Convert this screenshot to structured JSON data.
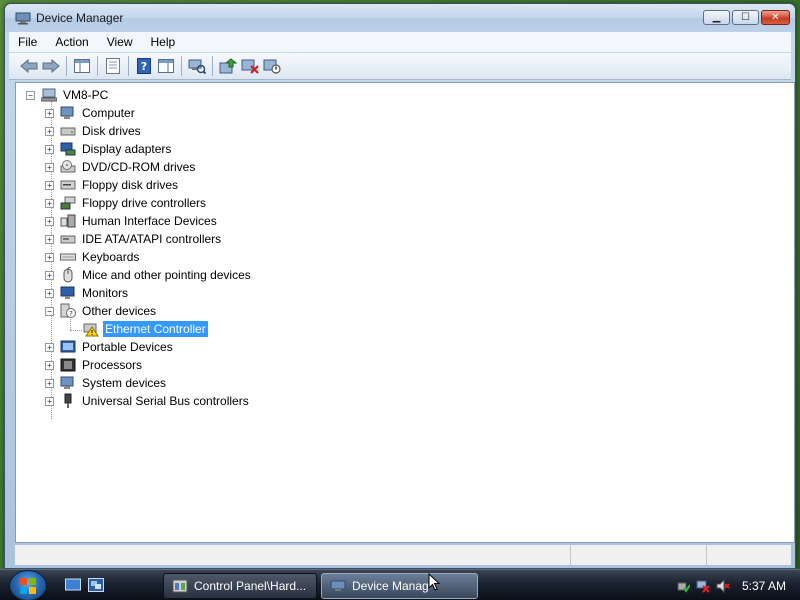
{
  "window": {
    "title": "Device Manager",
    "icon": "device-manager-icon"
  },
  "menu": [
    "File",
    "Action",
    "View",
    "Help"
  ],
  "toolbar": {
    "buttons": [
      "back-icon",
      "forward-icon",
      "show-hide-console-tree-icon",
      "properties-icon",
      "help-icon",
      "show-hide-action-pane-icon",
      "scan-hardware-icon",
      "update-driver-icon",
      "uninstall-icon",
      "disable-icon"
    ]
  },
  "tree": {
    "root": "VM8-PC",
    "categories": [
      {
        "label": "Computer",
        "icon": "computer-icon",
        "expanded": false
      },
      {
        "label": "Disk drives",
        "icon": "disk-drive-icon",
        "expanded": false
      },
      {
        "label": "Display adapters",
        "icon": "display-adapter-icon",
        "expanded": false
      },
      {
        "label": "DVD/CD-ROM drives",
        "icon": "dvd-drive-icon",
        "expanded": false
      },
      {
        "label": "Floppy disk drives",
        "icon": "floppy-disk-icon",
        "expanded": false
      },
      {
        "label": "Floppy drive controllers",
        "icon": "floppy-controller-icon",
        "expanded": false
      },
      {
        "label": "Human Interface Devices",
        "icon": "hid-icon",
        "expanded": false
      },
      {
        "label": "IDE ATA/ATAPI controllers",
        "icon": "ide-controller-icon",
        "expanded": false
      },
      {
        "label": "Keyboards",
        "icon": "keyboard-icon",
        "expanded": false
      },
      {
        "label": "Mice and other pointing devices",
        "icon": "mouse-icon",
        "expanded": false
      },
      {
        "label": "Monitors",
        "icon": "monitor-icon",
        "expanded": false
      },
      {
        "label": "Other devices",
        "icon": "unknown-device-icon",
        "expanded": true,
        "children": [
          {
            "label": "Ethernet Controller",
            "icon": "warning-device-icon",
            "selected": true
          }
        ]
      },
      {
        "label": "Portable Devices",
        "icon": "portable-device-icon",
        "expanded": false
      },
      {
        "label": "Processors",
        "icon": "processor-icon",
        "expanded": false
      },
      {
        "label": "System devices",
        "icon": "system-device-icon",
        "expanded": false
      },
      {
        "label": "Universal Serial Bus controllers",
        "icon": "usb-icon",
        "expanded": false
      }
    ]
  },
  "taskbar": {
    "buttons": [
      {
        "label": "Control Panel\\Hard...",
        "icon": "control-panel-icon",
        "active": false
      },
      {
        "label": "Device Manag",
        "icon": "device-manager-icon",
        "active": true
      }
    ],
    "clock": "5:37 AM"
  },
  "colors": {
    "selection": "#3399ff",
    "desktop": "#3f7a2e"
  }
}
